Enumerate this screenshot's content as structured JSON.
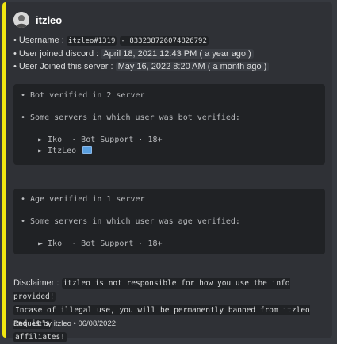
{
  "author": {
    "name": "itzleo",
    "avatar_icon": "user-avatar-icon"
  },
  "info": {
    "username_label": "• Username :",
    "username_value": "itzleo#1319",
    "username_id": "- 833238726074826792",
    "joined_discord_label": "• User joined discord :",
    "joined_discord_value": "April 18, 2021 12:43 PM",
    "joined_discord_rel": "( a year ago )",
    "joined_server_label": "• User Joined this server :",
    "joined_server_value": "May 16, 2022 8:20 AM",
    "joined_server_rel": "( a month ago )"
  },
  "bot_block": {
    "line1": "• Bot verified in 2 server",
    "line2": "• Some servers in which user was bot verified:",
    "servers": [
      "► Iko  · Bot Support · 18+",
      "► ItzLeo"
    ]
  },
  "age_block": {
    "line1": "• Age verified in 1 server",
    "line2": "• Some servers in which user was age verified:",
    "servers": [
      "► Iko  · Bot Support · 18+"
    ]
  },
  "disclaimer": {
    "label": "Disclaimer :",
    "text1": "itzleo is not responsible for how you use the info provided!",
    "text2": "Incase of illegal use, you will be permanently banned from itzleo and it's",
    "text3": "affiliates!"
  },
  "footer": {
    "text": "Request by itzleo • 06/08/2022"
  },
  "colors": {
    "embed_bar": "#f1e611",
    "embed_bg": "#2f3136",
    "code_bg": "#202225"
  }
}
